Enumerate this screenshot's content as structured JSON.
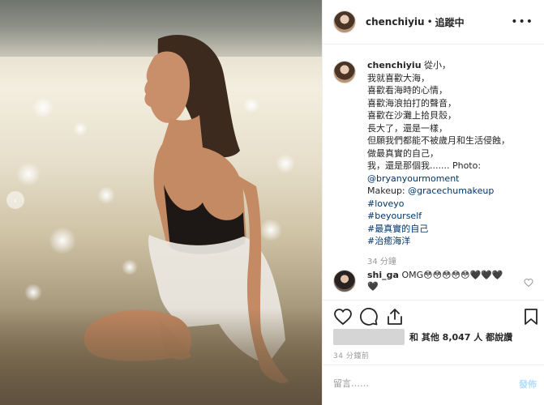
{
  "header": {
    "username": "chenchiyiu",
    "separator": "•",
    "follow_label": "追蹤中",
    "more_label": "•••"
  },
  "caption": {
    "username": "chenchiyiu",
    "lines": [
      "從小，",
      "我就喜歡大海，",
      "喜歡看海時的心情，",
      "喜歡海浪拍打的聲音，",
      "喜歡在沙灘上拾貝殼，",
      "長大了，還是一樣，",
      "但願我們都能不被歲月和生活侵蝕，",
      "做最真實的自己，",
      "我，還是那個我....... Photo:"
    ],
    "photo_credit": "@bryanyourmoment",
    "makeup_prefix": "Makeup: ",
    "makeup_credit": "@gracechumakeup",
    "hashtags": [
      "#loveyo",
      "#beyourself",
      "#最真實的自己",
      "#治癒海洋"
    ],
    "time": "34 分鐘"
  },
  "comment": {
    "username": "shi_ga",
    "text": "OMG😳😳😳😳😳🖤🖤🖤🖤"
  },
  "actions": {
    "icons": [
      "heart-icon",
      "comment-icon",
      "share-icon",
      "bookmark-icon"
    ]
  },
  "likes": {
    "text": "和 其他 8,047 人 都說讚"
  },
  "post_time": "34 分鐘前",
  "add_comment": {
    "placeholder": "留言……",
    "post_label": "發佈"
  }
}
